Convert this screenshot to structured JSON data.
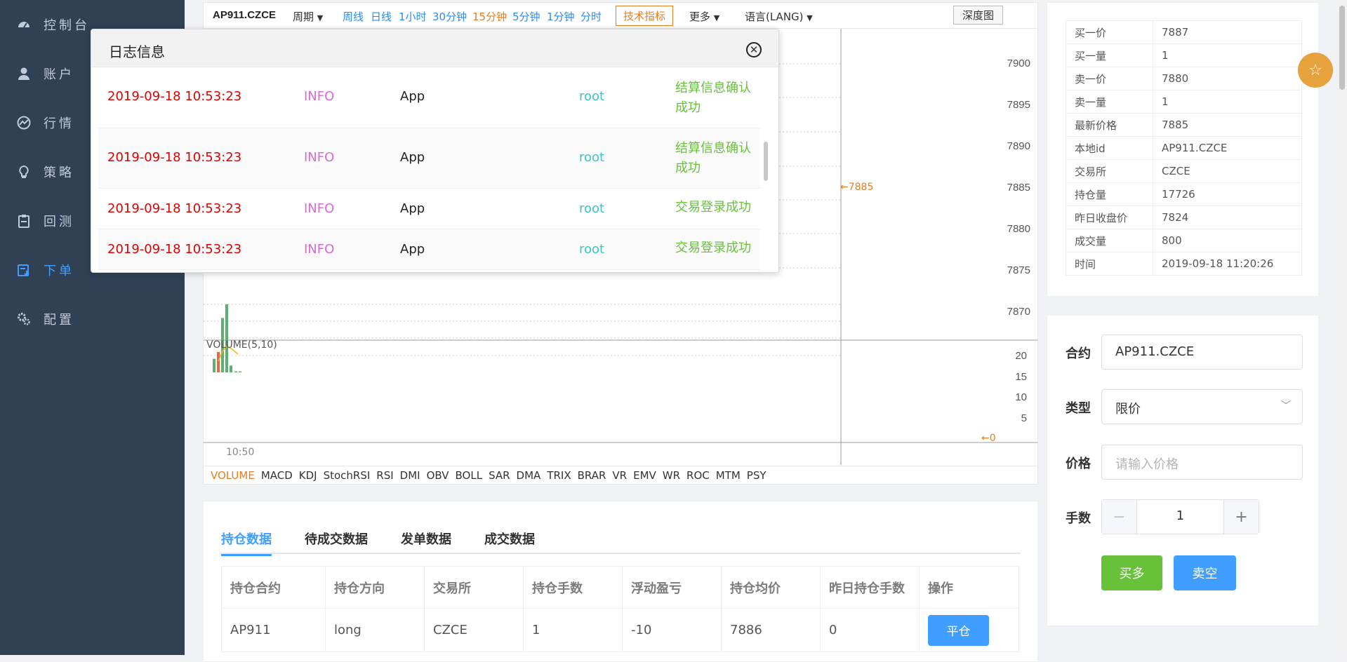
{
  "sidebar": {
    "items": [
      {
        "label": "控制台",
        "icon": "dashboard-icon"
      },
      {
        "label": "账户",
        "icon": "user-icon"
      },
      {
        "label": "行情",
        "icon": "chart-icon"
      },
      {
        "label": "策略",
        "icon": "bulb-icon"
      },
      {
        "label": "回测",
        "icon": "clipboard-icon"
      },
      {
        "label": "下单",
        "icon": "order-icon"
      },
      {
        "label": "配置",
        "icon": "gears-icon"
      }
    ],
    "active_index": 5
  },
  "chart": {
    "symbol": "AP911.CZCE",
    "period_label": "周期",
    "periods": [
      "周线",
      "日线",
      "1小时",
      "30分钟",
      "15分钟",
      "5分钟",
      "1分钟",
      "分时"
    ],
    "active_period": "15分钟",
    "indicator_button": "技术指标",
    "more_label": "更多",
    "lang_label": "语言(LANG)",
    "depth_button": "深度图",
    "price_axis": [
      "7900",
      "7895",
      "7890",
      "7885",
      "7880",
      "7875",
      "7870"
    ],
    "last_price_marker": "7885",
    "volume_label": "VOLUME(5,10)",
    "volume_axis": [
      "20",
      "15",
      "10",
      "5"
    ],
    "volume_zero_marker": "0",
    "time_label": "10:50",
    "indicators": [
      "VOLUME",
      "MACD",
      "KDJ",
      "StochRSI",
      "RSI",
      "DMI",
      "OBV",
      "BOLL",
      "SAR",
      "DMA",
      "TRIX",
      "BRAR",
      "VR",
      "EMV",
      "WR",
      "ROC",
      "MTM",
      "PSY"
    ],
    "active_indicator": "VOLUME",
    "colors": {
      "up": "#5fae72",
      "down": "#e06a43",
      "ma": "#f0b429"
    }
  },
  "log_modal": {
    "title": "日志信息",
    "rows": [
      {
        "time": "2019-09-18 10:53:23",
        "level": "INFO",
        "app": "App",
        "user": "root",
        "message": "结算信息确认成功"
      },
      {
        "time": "2019-09-18 10:53:23",
        "level": "INFO",
        "app": "App",
        "user": "root",
        "message": "结算信息确认成功"
      },
      {
        "time": "2019-09-18 10:53:23",
        "level": "INFO",
        "app": "App",
        "user": "root",
        "message": "交易登录成功"
      },
      {
        "time": "2019-09-18 10:53:23",
        "level": "INFO",
        "app": "App",
        "user": "root",
        "message": "交易登录成功"
      }
    ]
  },
  "quote": {
    "rows": [
      {
        "label": "买一价",
        "value": "7887"
      },
      {
        "label": "买一量",
        "value": "1"
      },
      {
        "label": "卖一价",
        "value": "7880"
      },
      {
        "label": "卖一量",
        "value": "1"
      },
      {
        "label": "最新价格",
        "value": "7885"
      },
      {
        "label": "本地id",
        "value": "AP911.CZCE"
      },
      {
        "label": "交易所",
        "value": "CZCE"
      },
      {
        "label": "持仓量",
        "value": "17726"
      },
      {
        "label": "昨日收盘价",
        "value": "7824"
      },
      {
        "label": "成交量",
        "value": "800"
      },
      {
        "label": "时间",
        "value": "2019-09-18 11:20:26"
      }
    ]
  },
  "order_form": {
    "contract_label": "合约",
    "contract_value": "AP911.CZCE",
    "type_label": "类型",
    "type_value": "限价",
    "price_label": "价格",
    "price_placeholder": "请输入价格",
    "qty_label": "手数",
    "qty_value": "1",
    "buy_label": "买多",
    "sell_label": "卖空"
  },
  "data_tabs": {
    "tabs": [
      "持仓数据",
      "待成交数据",
      "发单数据",
      "成交数据"
    ],
    "active_index": 0,
    "headers": [
      "持仓合约",
      "持仓方向",
      "交易所",
      "持仓手数",
      "浮动盈亏",
      "持仓均价",
      "昨日持仓手数",
      "操作"
    ],
    "rows": [
      {
        "contract": "AP911",
        "direction": "long",
        "exchange": "CZCE",
        "qty": "1",
        "pnl": "-10",
        "avg_price": "7886",
        "yd_qty": "0",
        "action": "平仓"
      }
    ]
  }
}
